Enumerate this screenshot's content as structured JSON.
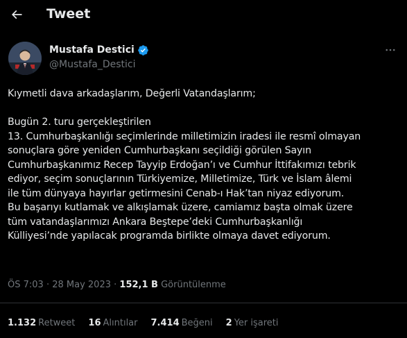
{
  "header": {
    "title": "Tweet",
    "back_icon": "arrow-left-icon"
  },
  "author": {
    "display_name": "Mustafa Destici",
    "handle": "@Mustafa_Destici",
    "verified": true,
    "verified_color": "#1d9bf0"
  },
  "tweet": {
    "paragraphs": [
      [
        "Kıymetli dava arkadaşlarım, Değerli Vatandaşlarım;"
      ],
      [
        "Bugün 2. turu gerçekleştirilen",
        "13. Cumhurbaşkanlığı seçimlerinde milletimizin iradesi ile resmî olmayan",
        "sonuçlara göre yeniden Cumhurbaşkanı seçildiği görülen Sayın",
        "Cumhurbaşkanımız Recep Tayyip Erdoğan’ı ve Cumhur İttifakımızı tebrik",
        "ediyor, seçim sonuçlarının Türkiyemize, Milletimize, Türk ve İslam âlemi",
        "ile tüm dünyaya hayırlar getirmesini Cenab-ı Hak’tan niyaz ediyorum.",
        "Bu başarıyı kutlamak ve alkışlamak üzere,  camiamız başta olmak üzere",
        "tüm vatandaşlarımızı Ankara Beştepe’deki Cumhurbaşkanlığı",
        "Külliyesi’nde yapılacak programda birlikte olmaya davet ediyorum."
      ]
    ]
  },
  "meta": {
    "time": "ÖS 7:03",
    "separator": " · ",
    "date": "28 May 2023",
    "views_count": "152,1 B",
    "views_label": "Görüntülenme"
  },
  "stats": [
    {
      "count": "1.132",
      "label": "Retweet"
    },
    {
      "count": "16",
      "label": "Alıntılar"
    },
    {
      "count": "7.414",
      "label": "Beğeni"
    },
    {
      "count": "2",
      "label": "Yer işareti"
    }
  ],
  "colors": {
    "background": "#000000",
    "text": "#e7e9ea",
    "muted": "#71767b",
    "divider": "#2f3336",
    "accent": "#1d9bf0"
  }
}
